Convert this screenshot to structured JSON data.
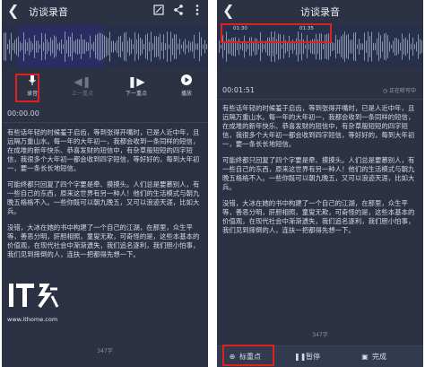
{
  "left": {
    "title": "访谈录音",
    "controls": [
      {
        "label": "录音"
      },
      {
        "label": "上一重点"
      },
      {
        "label": "下一重点"
      },
      {
        "label": "播放"
      }
    ],
    "timer": "00:00.00",
    "paragraphs": [
      "有些话年轻的时候羞于启齿，等到张得开嘴时，已是人近中年，且远隔万重山水。每一年的大年初一，我都会收到一条同样的短信，在成堆的新年快乐、恭喜发财的短信中，有杂草般短短的四字短信，我很多个大年初一都会收到四字短信，等好好的，每到大年初一，要一条长长地短信。",
      "可能终都只回复了四个字要是牵、摸摸头。人们总是要慕别人，有一些自己的东西，原来这世界有另一种人！他们的生活模式与朝九晚五格格不入。一些你既可以朝九晚五，又可以浪迹天涯，比如大兵。",
      "没错，大冰在她的书中构建了一个自己的江湖，在那里，众生平等，善恶分明，肝胆相照，童叟无欺，可奇怪的是，这些本基本的价值观，在现代社会中渐渐遗失，我们追名逐利，我们胆小怕事，我们见到摔倒的人，连扶一把都得先想一下。"
    ],
    "word_count": "347字",
    "logo_text": "IT之家",
    "logo_url": "www.ithome.com"
  },
  "right": {
    "title": "访谈录音",
    "wave_times": [
      "01:30",
      "01:35"
    ],
    "timer": "00:01:51",
    "status": "正在听写中",
    "paragraphs": [
      "有些话年轻的时候羞于启齿，等到张得开嘴时，已是人近中年，且远隔万重山水。每一年的大年初一，我都会收到一条同样的短信，在成堆的新年快乐、恭喜发财的短信中，有杂草般短短的四字短信，我很多个大年初一都会收到四字短信，等好好的，每到大年初一，要一条长长地短信。",
      "可能终都只回复了四个字要是牵、摸摸头。人们总是要慕别人，有一些自己的东西，原来这世界有另一种人！他们的生活模式与朝九晚五格格不入。一些你既可以朝九晚五，又可以浪迹天涯，比如大兵。",
      "没错，大冰在她的书中构建了一个自己的江湖，在那里，众生平等，善恶分明，肝胆相照，童叟无欺，可奇怪的是，这些本基本的价值观，在现代社会中渐渐遗失，我们追名逐利，我们胆小怕事，我们见到摔倒的人，连扶一把都得先想一下。"
    ],
    "word_count": "347字",
    "bottom": {
      "mark": "标重点",
      "pause": "暂停",
      "done": "完成"
    }
  },
  "colors": {
    "bg": "#2c3244",
    "wave": "#7d8aa5",
    "highlight": "#e0201f",
    "accent": "#4a5bd0"
  },
  "icons": [
    "back-arrow-icon",
    "edit-icon",
    "share-icon",
    "menu-icon",
    "microphone-icon",
    "previous-mark-icon",
    "next-mark-icon",
    "play-icon",
    "clock-icon",
    "mark-icon",
    "pause-icon",
    "done-icon"
  ]
}
